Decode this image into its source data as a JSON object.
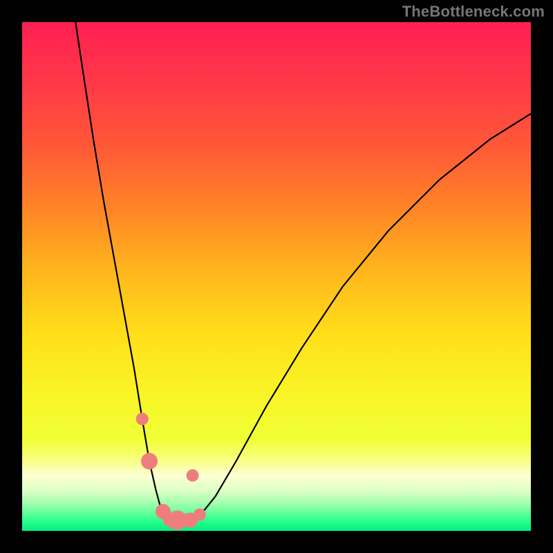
{
  "watermark": "TheBottleneck.com",
  "colors": {
    "frame_bg": "#000000",
    "curve": "#000000",
    "marker": "#ef7d7d",
    "watermark": "#767676"
  },
  "gradient_stops": [
    {
      "offset": 0.0,
      "color": "#ff1f52"
    },
    {
      "offset": 0.12,
      "color": "#ff3948"
    },
    {
      "offset": 0.25,
      "color": "#ff5a36"
    },
    {
      "offset": 0.38,
      "color": "#ff8a25"
    },
    {
      "offset": 0.5,
      "color": "#ffba1c"
    },
    {
      "offset": 0.62,
      "color": "#ffe01a"
    },
    {
      "offset": 0.74,
      "color": "#f8f628"
    },
    {
      "offset": 0.82,
      "color": "#f0ff36"
    },
    {
      "offset": 0.86,
      "color": "#f8ff80"
    },
    {
      "offset": 0.89,
      "color": "#fdffd0"
    },
    {
      "offset": 0.92,
      "color": "#e0ffc8"
    },
    {
      "offset": 0.95,
      "color": "#96ffa8"
    },
    {
      "offset": 0.98,
      "color": "#2cff8e"
    },
    {
      "offset": 1.0,
      "color": "#00ef7e"
    }
  ],
  "chart_data": {
    "type": "line",
    "title": "",
    "xlabel": "",
    "ylabel": "",
    "grid": false,
    "legend": false,
    "xlim": [
      0,
      100
    ],
    "ylim": [
      0,
      100
    ],
    "series": [
      {
        "name": "left-branch",
        "x": [
          10.5,
          12,
          14,
          16,
          18,
          20,
          22,
          23.6,
          25,
          26.3,
          27,
          27.7,
          28.4,
          29.8,
          30.5
        ],
        "y": [
          100,
          90,
          77,
          65,
          54,
          43,
          32,
          22,
          13.7,
          8,
          5.4,
          3.8,
          2.9,
          2.2,
          2.1
        ]
      },
      {
        "name": "right-branch",
        "x": [
          30.5,
          33.5,
          34.9,
          36,
          38,
          42,
          48,
          55,
          63,
          72,
          82,
          92,
          100
        ],
        "y": [
          2.1,
          2.2,
          3.2,
          4.3,
          6.8,
          13.6,
          24.5,
          36,
          48,
          59,
          69,
          77,
          82
        ]
      }
    ],
    "markers": [
      {
        "x": 23.6,
        "y": 22,
        "r": 9
      },
      {
        "x": 25.0,
        "y": 13.7,
        "r": 12
      },
      {
        "x": 33.5,
        "y": 10.9,
        "r": 9
      },
      {
        "x": 27.7,
        "y": 3.8,
        "r": 11
      },
      {
        "x": 30.5,
        "y": 2.1,
        "r": 14
      },
      {
        "x": 33.0,
        "y": 2.1,
        "r": 11
      },
      {
        "x": 34.9,
        "y": 3.2,
        "r": 9
      }
    ],
    "bottom_pill": {
      "x0": 27.7,
      "x1": 33.0,
      "y": 2.1,
      "h": 2.6
    }
  }
}
